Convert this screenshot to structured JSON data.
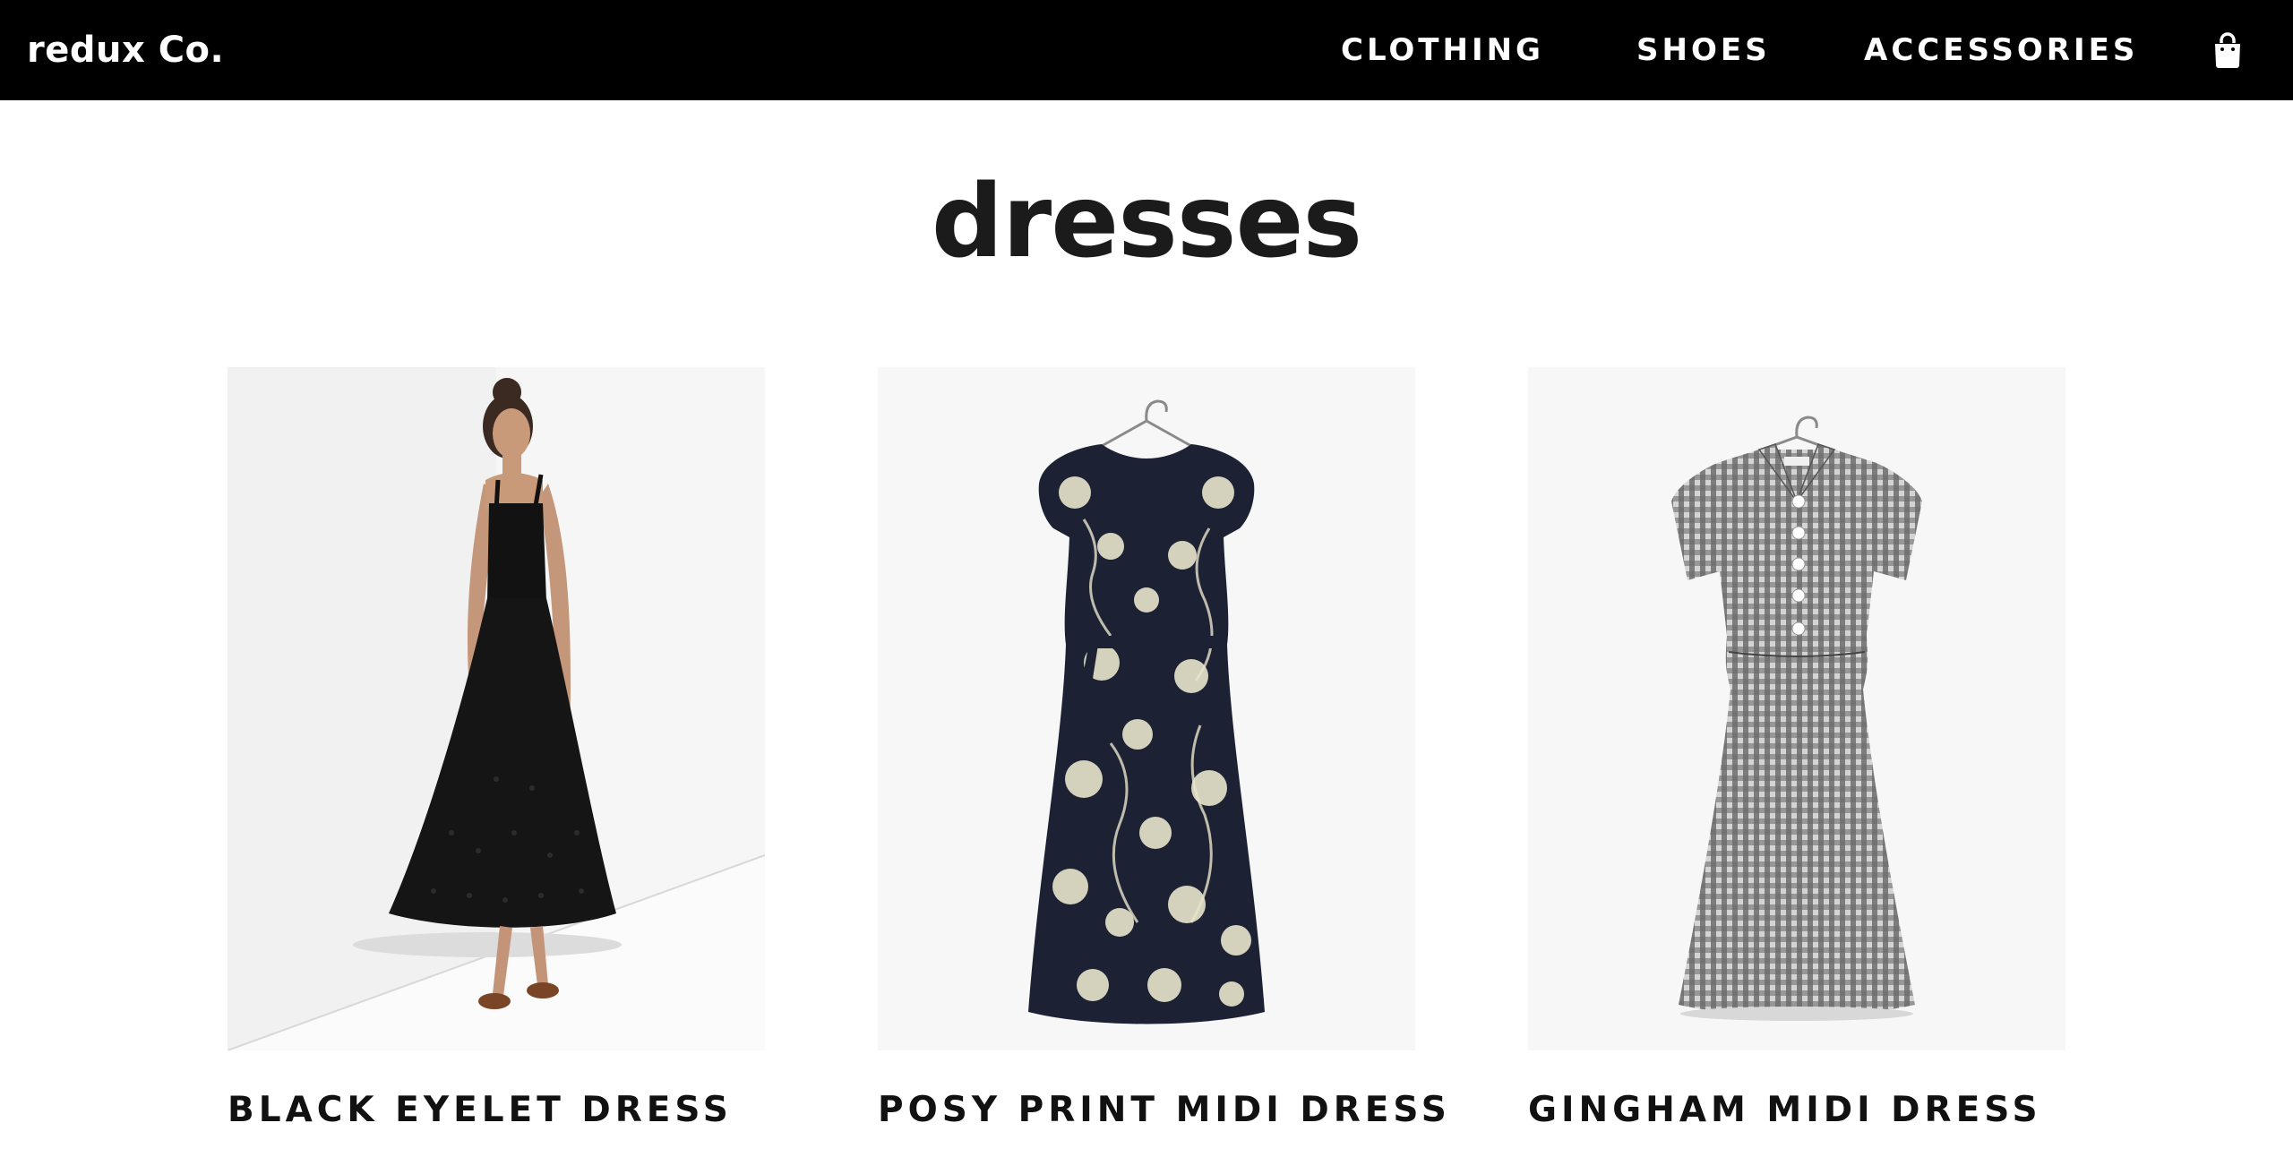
{
  "header": {
    "brand": "redux Co.",
    "nav": [
      {
        "label": "CLOTHING"
      },
      {
        "label": "SHOES"
      },
      {
        "label": "ACCESSORIES"
      }
    ],
    "cart_icon": "shopping-bag-icon"
  },
  "main": {
    "title": "dresses",
    "products": [
      {
        "name": "BLACK EYELET DRESS",
        "image": "model-wearing-black-dress"
      },
      {
        "name": "POSY PRINT MIDI DRESS",
        "image": "floral-dress-on-hanger"
      },
      {
        "name": "GINGHAM MIDI DRESS",
        "image": "gingham-dress-on-hanger"
      }
    ]
  },
  "colors": {
    "header_bg": "#000000",
    "header_text": "#ffffff",
    "page_bg": "#ffffff",
    "title_text": "#1b1b1b",
    "image_bg": "#f7f7f7"
  }
}
